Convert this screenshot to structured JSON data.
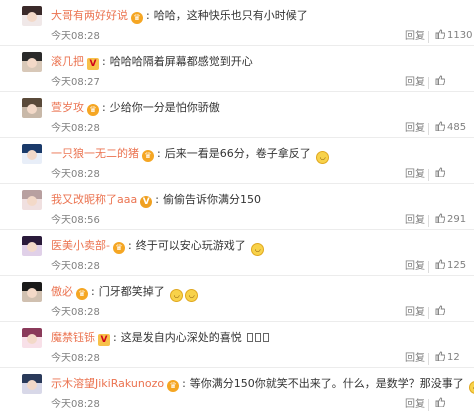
{
  "comments": [
    {
      "user": "大哥有两好好说",
      "badge": "crown",
      "text": "哈哈，这种快乐也只有小时候了",
      "emojis": 0,
      "boxes": 0,
      "time": "今天08:28",
      "reply": "回复",
      "likes": "1130",
      "avatar": [
        "#3a2a2a",
        "#f0e8e8"
      ]
    },
    {
      "user": "滚几把",
      "badge": "vip",
      "text": "哈哈哈隔着屏幕都感觉到开心",
      "emojis": 0,
      "boxes": 0,
      "time": "今天08:27",
      "reply": "回复",
      "likes": "",
      "avatar": [
        "#2a2a2a",
        "#d8c8b8"
      ]
    },
    {
      "user": "萱岁攻",
      "badge": "crown",
      "text": "少给你一分是怕你骄傲",
      "emojis": 0,
      "boxes": 0,
      "time": "今天08:28",
      "reply": "回复",
      "likes": "485",
      "avatar": [
        "#5a4a3a",
        "#c8b8a8"
      ]
    },
    {
      "user": "一只狼一无二的猪",
      "badge": "crown",
      "text": "后来一看是66分，卷子拿反了",
      "emojis": 1,
      "boxes": 0,
      "time": "今天08:28",
      "reply": "回复",
      "likes": "",
      "avatar": [
        "#1a3a6a",
        "#e8eef8"
      ]
    },
    {
      "user": "我又改昵称了aaa",
      "badge": "v",
      "text": "偷偷告诉你满分150",
      "emojis": 0,
      "boxes": 0,
      "time": "今天08:56",
      "reply": "回复",
      "likes": "291",
      "avatar": [
        "#b8a0a0",
        "#f0e0e0"
      ]
    },
    {
      "user": "医美小卖部-",
      "badge": "crown",
      "text": "终于可以安心玩游戏了",
      "emojis": 1,
      "boxes": 0,
      "time": "今天08:28",
      "reply": "回复",
      "likes": "125",
      "avatar": [
        "#2a1a3a",
        "#e0d0e8"
      ]
    },
    {
      "user": "傲必",
      "badge": "crown",
      "text": "门牙都笑掉了",
      "emojis": 2,
      "boxes": 0,
      "time": "今天08:28",
      "reply": "回复",
      "likes": "",
      "avatar": [
        "#1a1a1a",
        "#d0c0b0"
      ]
    },
    {
      "user": "魔禁钰铄",
      "badge": "vip",
      "text": "这是发自内心深处的喜悦",
      "emojis": 0,
      "boxes": 3,
      "time": "今天08:28",
      "reply": "回复",
      "likes": "12",
      "avatar": [
        "#8a3a5a",
        "#f8e0e8"
      ]
    },
    {
      "user": "示木溶望JikiRakunozo",
      "badge": "crown",
      "text": "等你满分150你就笑不出来了。什么，是数学？那没事了",
      "emojis": 1,
      "boxes": 0,
      "time": "今天08:28",
      "reply": "回复",
      "likes": "",
      "avatar": [
        "#2a3a5a",
        "#d8d8e8"
      ]
    }
  ]
}
